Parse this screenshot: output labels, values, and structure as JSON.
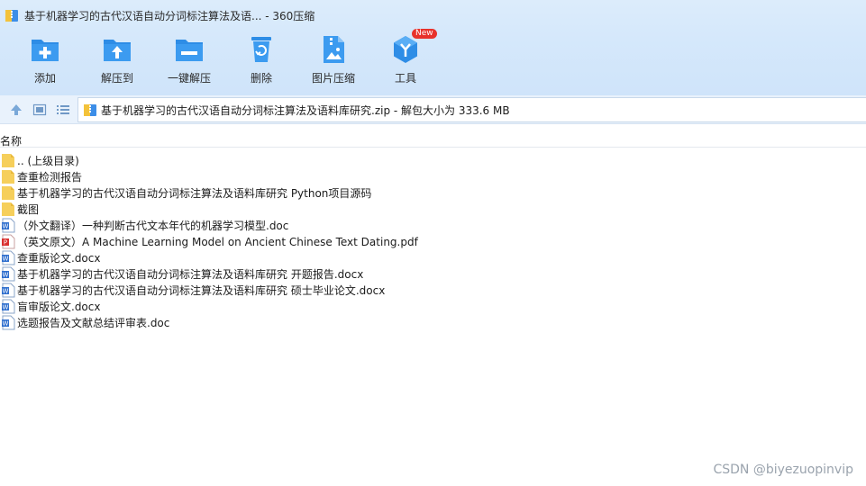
{
  "window": {
    "title": "基于机器学习的古代汉语自动分词标注算法及语... - 360压缩"
  },
  "toolbar": {
    "items": [
      {
        "label": "添加",
        "icon": "add-icon"
      },
      {
        "label": "解压到",
        "icon": "extract-to-icon"
      },
      {
        "label": "一键解压",
        "icon": "one-click-extract-icon"
      },
      {
        "label": "删除",
        "icon": "delete-icon"
      },
      {
        "label": "图片压缩",
        "icon": "image-compress-icon"
      },
      {
        "label": "工具",
        "icon": "tools-icon",
        "badge": "New"
      }
    ]
  },
  "nav": {
    "path": "基于机器学习的古代汉语自动分词标注算法及语料库研究.zip - 解包大小为 333.6 MB"
  },
  "list": {
    "column_name": "名称",
    "items": [
      {
        "name": ".. (上级目录)",
        "type": "folder"
      },
      {
        "name": "查重检测报告",
        "type": "folder"
      },
      {
        "name": "基于机器学习的古代汉语自动分词标注算法及语料库研究 Python项目源码",
        "type": "folder"
      },
      {
        "name": "截图",
        "type": "folder"
      },
      {
        "name": "（外文翻译）一种判断古代文本年代的机器学习模型.doc",
        "type": "word"
      },
      {
        "name": "（英文原文）A Machine Learning Model on Ancient Chinese Text Dating.pdf",
        "type": "pdf"
      },
      {
        "name": "查重版论文.docx",
        "type": "word"
      },
      {
        "name": "基于机器学习的古代汉语自动分词标注算法及语料库研究 开题报告.docx",
        "type": "word"
      },
      {
        "name": "基于机器学习的古代汉语自动分词标注算法及语料库研究 硕士毕业论文.docx",
        "type": "word"
      },
      {
        "name": "盲审版论文.docx",
        "type": "word"
      },
      {
        "name": "选题报告及文献总结评审表.doc",
        "type": "word"
      }
    ]
  },
  "watermark": "CSDN @biyezuopinvip",
  "colors": {
    "toolbar_blue": "#2e8de6",
    "folder_yellow": "#f6cf5b",
    "word_blue": "#2f6fce",
    "pdf_red": "#d9302f",
    "badge_red": "#e8322b"
  }
}
